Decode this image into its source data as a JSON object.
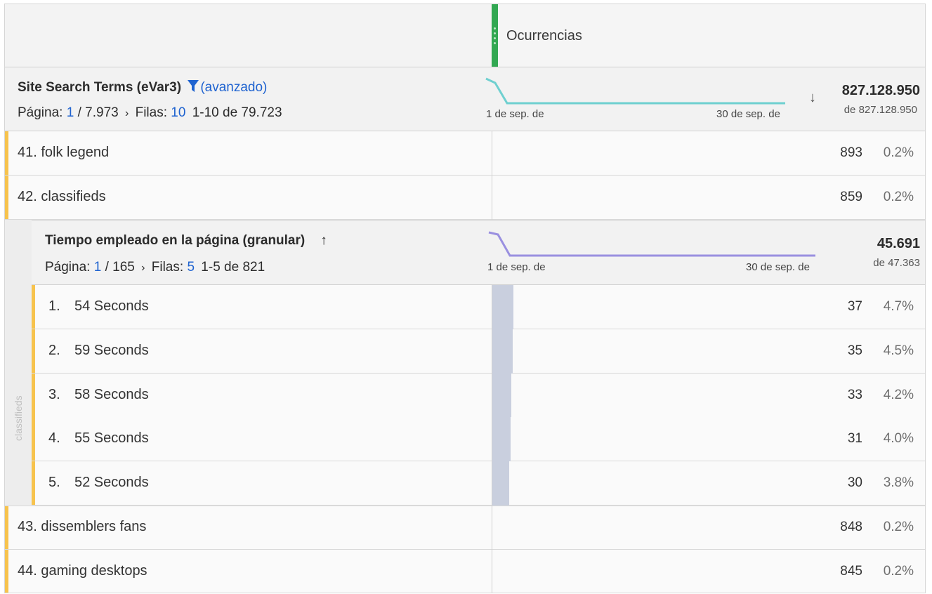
{
  "column": {
    "title": "Ocurrencias"
  },
  "colors": {
    "accent": "#f7c34d",
    "metric": "#32a852",
    "trend1": "#6fd0d0",
    "trend2": "#9a90e0",
    "link": "#1f63d0"
  },
  "outer": {
    "title": "Site Search Terms (eVar3)",
    "filter_label": "(avanzado)",
    "page_label": "Página:",
    "page": "1",
    "page_total": "/ 7.973",
    "rows_label": "Filas:",
    "rows": "10",
    "range": "1-10 de 79.723",
    "axis_start": "1 de sep. de",
    "axis_end": "30 de sep. de",
    "total": "827.128.950",
    "total_of": "de 827.128.950"
  },
  "outer_rows": [
    {
      "label": "41. folk legend",
      "value": "893",
      "pct": "0.2%"
    },
    {
      "label": "42. classifieds",
      "value": "859",
      "pct": "0.2%"
    },
    {
      "label": "43. dissemblers fans",
      "value": "848",
      "pct": "0.2%"
    },
    {
      "label": "44. gaming desktops",
      "value": "845",
      "pct": "0.2%"
    }
  ],
  "inner": {
    "side_label": "classifieds",
    "title": "Tiempo empleado en la página (granular)",
    "page_label": "Página:",
    "page": "1",
    "page_total": "/ 165",
    "rows_label": "Filas:",
    "rows": "5",
    "range": "1-5 de 821",
    "axis_start": "1 de sep. de",
    "axis_end": "30 de sep. de",
    "total": "45.691",
    "total_of": "de 47.363",
    "rows_data": [
      {
        "idx": "1.",
        "label": "54 Seconds",
        "value": "37",
        "pct": "4.7%",
        "share": 0.047
      },
      {
        "idx": "2.",
        "label": "59 Seconds",
        "value": "35",
        "pct": "4.5%",
        "share": 0.045
      },
      {
        "idx": "3.",
        "label": "58 Seconds",
        "value": "33",
        "pct": "4.2%",
        "share": 0.042
      },
      {
        "idx": "4.",
        "label": "55 Seconds",
        "value": "31",
        "pct": "4.0%",
        "share": 0.04
      },
      {
        "idx": "5.",
        "label": "52 Seconds",
        "value": "30",
        "pct": "3.8%",
        "share": 0.038
      }
    ]
  }
}
